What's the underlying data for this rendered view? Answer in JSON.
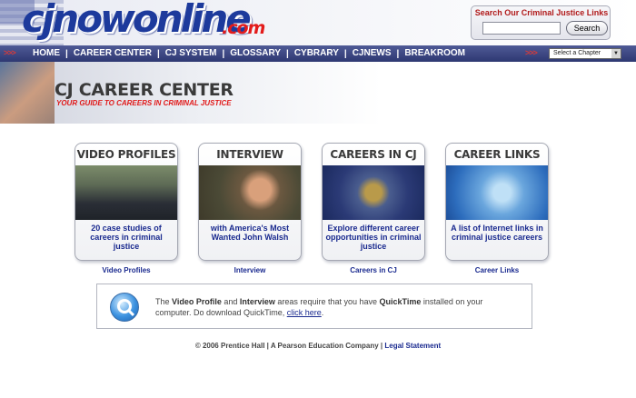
{
  "header": {
    "logo_main": "cjnowonline",
    "logo_suffix": ".com",
    "search": {
      "title": "Search Our Criminal Justice Links",
      "input_value": "",
      "button_label": "Search"
    }
  },
  "nav": {
    "arrows": ">>>",
    "items": [
      {
        "label": "HOME"
      },
      {
        "label": "CAREER CENTER"
      },
      {
        "label": "CJ SYSTEM"
      },
      {
        "label": "GLOSSARY"
      },
      {
        "label": "CYBRARY"
      },
      {
        "label": "CJNEWS"
      },
      {
        "label": "BREAKROOM"
      }
    ],
    "separator": "|",
    "chapter_select": "Select a Chapter"
  },
  "banner": {
    "title": "CJ CAREER CENTER",
    "subtitle": "YOUR GUIDE TO CAREERS IN CRIMINAL JUSTICE"
  },
  "cards": [
    {
      "title": "VIDEO PROFILES",
      "description": "20 case studies of careers in criminal justice",
      "link": "Video Profiles"
    },
    {
      "title": "INTERVIEW",
      "description": "with America's Most Wanted John Walsh",
      "link": "Interview"
    },
    {
      "title": "CAREERS IN CJ",
      "description": "Explore different career opportunities in criminal justice",
      "link": "Careers in CJ"
    },
    {
      "title": "CAREER LINKS",
      "description": "A list of Internet links in criminal justice careers",
      "link": "Career Links"
    }
  ],
  "notice": {
    "part1": "The ",
    "bold1": "Video Profile",
    "part2": " and ",
    "bold2": "Interview",
    "part3": " areas require that you have ",
    "bold3": "QuickTime",
    "part4": " installed on your computer. Do download QuickTime, ",
    "link": "click here",
    "part5": "."
  },
  "footer": {
    "copyright": "© 2006 Prentice Hall | A Pearson Education Company | ",
    "legal": "Legal Statement"
  },
  "colors": {
    "brand_blue": "#1d3a9c",
    "accent_red": "#e31b1b",
    "link_blue": "#1a2a8f",
    "nav_bg": "#3a4482"
  }
}
